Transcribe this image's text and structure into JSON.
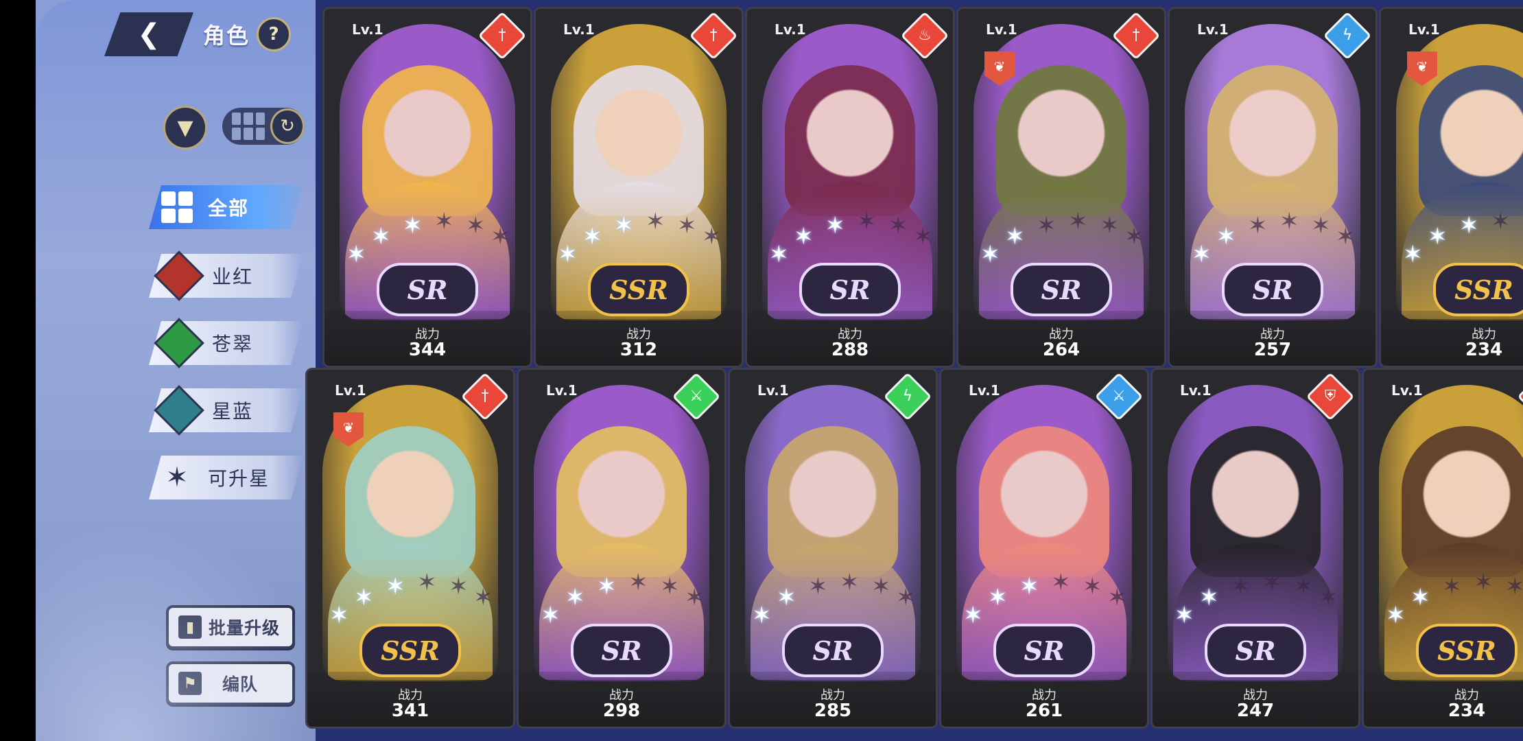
{
  "header": {
    "back_icon": "back-arrow-icon",
    "title": "角色",
    "help_label": "?"
  },
  "toolbar": {
    "filter_icon": "filter-funnel-icon",
    "grid_icon": "grid-view-icon",
    "refresh_icon": "refresh-icon"
  },
  "tabs": [
    {
      "label": "全部",
      "icon": "all-grid-icon",
      "color": "#4a86f0"
    },
    {
      "label": "业红",
      "icon": "red-diamond-icon",
      "color": "#b3342c"
    },
    {
      "label": "苍翠",
      "icon": "green-diamond-icon",
      "color": "#2f9a45"
    },
    {
      "label": "星蓝",
      "icon": "teal-diamond-icon",
      "color": "#2f7f8f"
    },
    {
      "label": "可升星",
      "icon": "star-burst-icon",
      "color": "#2d3456"
    }
  ],
  "actions": {
    "batch_upgrade": "批量升级",
    "formation": "编队"
  },
  "power_label": "战力",
  "cards": [
    {
      "level": "Lv.1",
      "rarity": "SR",
      "power": "344",
      "element_color": "#e8473a",
      "element_icon": "sword-icon",
      "stars": 3,
      "theme": "#9a5ac8",
      "hair": "#f2b84a",
      "class_badge": false
    },
    {
      "level": "Lv.1",
      "rarity": "SSR",
      "power": "312",
      "element_color": "#e8473a",
      "element_icon": "sword-icon",
      "stars": 3,
      "theme": "#c9a03a",
      "hair": "#e6dde8",
      "class_badge": false
    },
    {
      "level": "Lv.1",
      "rarity": "SR",
      "power": "288",
      "element_color": "#e8473a",
      "element_icon": "flame-icon",
      "stars": 3,
      "theme": "#9a5ac8",
      "hair": "#7a2a4a",
      "class_badge": false
    },
    {
      "level": "Lv.1",
      "rarity": "SR",
      "power": "264",
      "element_color": "#e8473a",
      "element_icon": "sword-icon",
      "stars": 2,
      "theme": "#9a5ac8",
      "hair": "#6f7a3a",
      "class_badge": true
    },
    {
      "level": "Lv.1",
      "rarity": "SR",
      "power": "257",
      "element_color": "#3a9fe8",
      "element_icon": "lightning-icon",
      "stars": 2,
      "theme": "#a77ad8",
      "hair": "#d6b46a",
      "class_badge": false
    },
    {
      "level": "Lv.1",
      "rarity": "SSR",
      "power": "234",
      "element_color": "#e8473a",
      "element_icon": "sword-icon",
      "stars": 3,
      "theme": "#c9a03a",
      "hair": "#3a4a7a",
      "class_badge": true
    },
    {
      "level": "Lv.1",
      "rarity": "SSR",
      "power": "341",
      "element_color": "#e8473a",
      "element_icon": "sword-icon",
      "stars": 3,
      "theme": "#c9a03a",
      "hair": "#9fd0c8",
      "class_badge": true
    },
    {
      "level": "Lv.1",
      "rarity": "SR",
      "power": "298",
      "element_color": "#3ad05a",
      "element_icon": "blade-icon",
      "stars": 3,
      "theme": "#9a5ac8",
      "hair": "#e6c060",
      "class_badge": false
    },
    {
      "level": "Lv.1",
      "rarity": "SR",
      "power": "285",
      "element_color": "#3ad05a",
      "element_icon": "lightning-icon",
      "stars": 2,
      "theme": "#8a6ac8",
      "hair": "#c9a86a",
      "class_badge": false
    },
    {
      "level": "Lv.1",
      "rarity": "SR",
      "power": "261",
      "element_color": "#3a9fe8",
      "element_icon": "blade-icon",
      "stars": 3,
      "theme": "#9a5ac8",
      "hair": "#f08a7a",
      "class_badge": false
    },
    {
      "level": "Lv.1",
      "rarity": "SR",
      "power": "247",
      "element_color": "#e8473a",
      "element_icon": "shield-icon",
      "stars": 2,
      "theme": "#8a5ac0",
      "hair": "#222222",
      "class_badge": false
    },
    {
      "level": "Lv.1",
      "rarity": "SSR",
      "power": "234",
      "element_color": "#e8473a",
      "element_icon": "sword-icon",
      "stars": 2,
      "theme": "#c9a03a",
      "hair": "#5a3a2a",
      "class_badge": false
    }
  ]
}
